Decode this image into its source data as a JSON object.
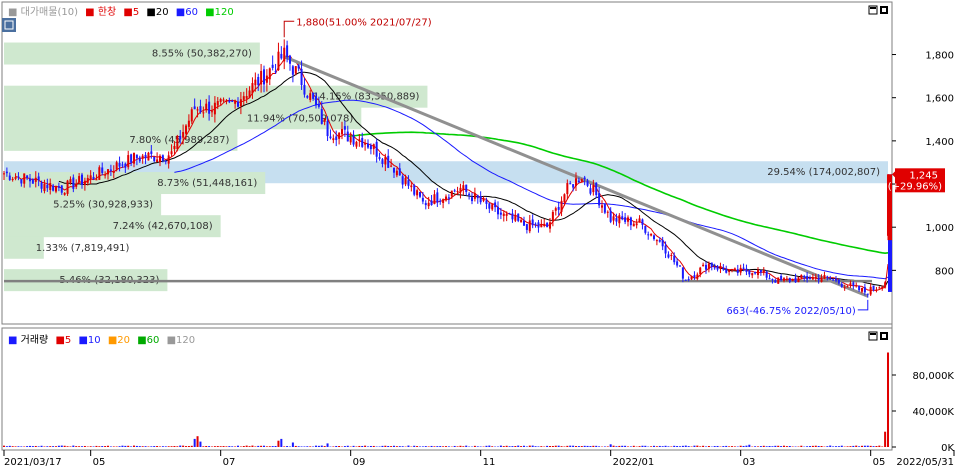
{
  "price_panel": {
    "legend": {
      "name": "대가매물(10)",
      "series_name": "한창",
      "ma": [
        {
          "label": "5",
          "color": "#e00000"
        },
        {
          "label": "20",
          "color": "#000000"
        },
        {
          "label": "60",
          "color": "#1a1aff"
        },
        {
          "label": "120",
          "color": "#00cc00"
        }
      ]
    },
    "high_label": "1,880(51.00% 2021/07/27)",
    "low_label": "663(-46.75% 2022/05/10)",
    "current_price": "1,245",
    "current_change": "(+29.96%)",
    "volume_profile": [
      {
        "price": 1800,
        "text": "8.55% (50,382,270)"
      },
      {
        "price": 1600,
        "text": "14.15% (83,350,889)"
      },
      {
        "price": 1500,
        "text": "11.94% (70,509,078)"
      },
      {
        "price": 1400,
        "text": "7.80% (45,989,287)"
      },
      {
        "price": 1250,
        "text": "29.54% (174,002,807)"
      },
      {
        "price": 1200,
        "text": "8.73% (51,448,161)"
      },
      {
        "price": 1100,
        "text": "5.25% (30,928,933)"
      },
      {
        "price": 1000,
        "text": "7.24% (42,670,108)"
      },
      {
        "price": 900,
        "text": "1.33% (7,819,491)"
      },
      {
        "price": 750,
        "text": "5.46% (32,180,323)"
      }
    ]
  },
  "volume_panel": {
    "legend": {
      "name": "거래량",
      "ma": [
        {
          "label": "5",
          "color": "#e00000"
        },
        {
          "label": "10",
          "color": "#1a1aff"
        },
        {
          "label": "20",
          "color": "#ff9900"
        },
        {
          "label": "60",
          "color": "#00aa00"
        },
        {
          "label": "120",
          "color": "#999999"
        }
      ]
    }
  },
  "colors": {
    "up": "#e00000",
    "down": "#1a1aff",
    "profile": "#cfe8cf",
    "profile_max": "#c6dff0",
    "trendline": "#909090",
    "support": "#808080"
  },
  "chart_data": [
    {
      "type": "candlestick",
      "x_ticks": [
        "2021/03/17",
        "05",
        "07",
        "09",
        "11",
        "2022/01",
        "03",
        "05",
        "2022/05/31"
      ],
      "x_tick_pos": [
        0,
        30,
        75,
        120,
        165,
        210,
        255,
        300,
        330
      ],
      "y_ticks": [
        800,
        1000,
        1200,
        1400,
        1600,
        1800
      ],
      "y_tick_labels": [
        "800",
        "1,000",
        "",
        "1,400",
        "1,600",
        "1,800"
      ],
      "ylim": [
        570,
        1960
      ],
      "n_days": 306,
      "waypoints": [
        [
          0,
          1250
        ],
        [
          20,
          1180
        ],
        [
          30,
          1230
        ],
        [
          45,
          1320
        ],
        [
          58,
          1340
        ],
        [
          66,
          1550
        ],
        [
          78,
          1560
        ],
        [
          90,
          1700
        ],
        [
          97,
          1800
        ],
        [
          103,
          1680
        ],
        [
          112,
          1450
        ],
        [
          125,
          1400
        ],
        [
          135,
          1280
        ],
        [
          145,
          1110
        ],
        [
          158,
          1180
        ],
        [
          170,
          1070
        ],
        [
          180,
          1010
        ],
        [
          188,
          1000
        ],
        [
          195,
          1180
        ],
        [
          200,
          1240
        ],
        [
          206,
          1130
        ],
        [
          210,
          1040
        ],
        [
          220,
          1020
        ],
        [
          228,
          920
        ],
        [
          236,
          760
        ],
        [
          244,
          830
        ],
        [
          252,
          790
        ],
        [
          260,
          800
        ],
        [
          268,
          750
        ],
        [
          275,
          760
        ],
        [
          283,
          770
        ],
        [
          290,
          740
        ],
        [
          298,
          700
        ],
        [
          302,
          720
        ],
        [
          306,
          760
        ]
      ],
      "last_day": {
        "open": 960,
        "high": 1245,
        "low": 940,
        "close": 1245
      },
      "support_level": 750,
      "trendline": [
        [
          97,
          1790
        ],
        [
          299,
          680
        ]
      ],
      "high": {
        "day": 97,
        "value": 1880
      },
      "low": {
        "day": 299,
        "value": 663
      }
    },
    {
      "type": "bar",
      "y_ticks": [
        0,
        40000,
        80000
      ],
      "y_tick_labels": [
        "0K",
        "40,000K",
        "80,000K"
      ],
      "ylim": [
        0,
        110000
      ],
      "spikes": [
        [
          66,
          9000
        ],
        [
          67,
          12000
        ],
        [
          68,
          6000
        ],
        [
          95,
          7000
        ],
        [
          96,
          9000
        ],
        [
          100,
          5000
        ],
        [
          112,
          4000
        ],
        [
          210,
          3000
        ],
        [
          258,
          2500
        ],
        [
          305,
          17000
        ],
        [
          306,
          105000
        ]
      ]
    }
  ]
}
